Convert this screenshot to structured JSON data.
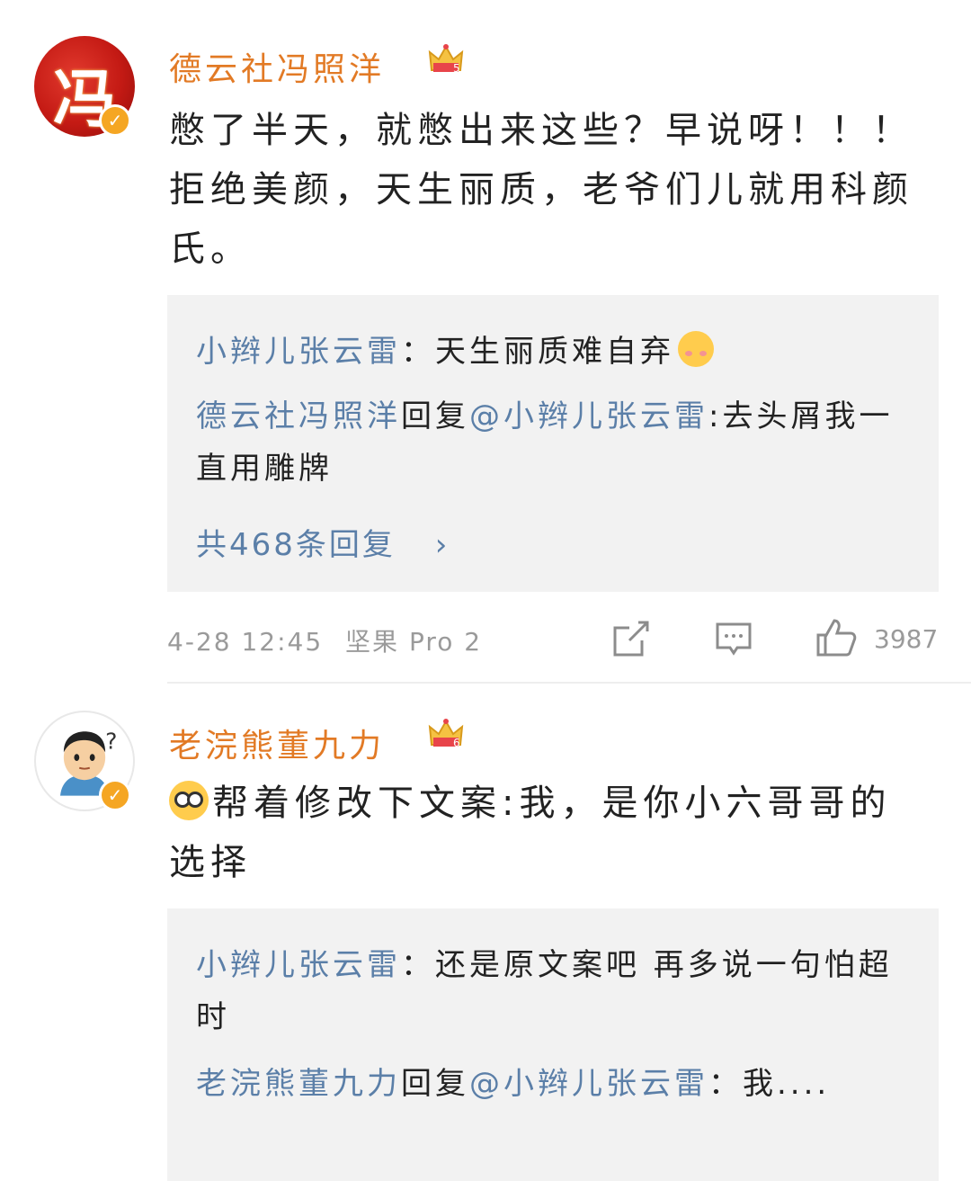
{
  "comments": [
    {
      "username": "德云社冯照洋",
      "avatar_glyph": "冯",
      "level_badge": "5",
      "text": "憋了半天，就憋出来这些？早说呀！！！        拒绝美颜，天生丽质，老爷们儿就用科颜氏。",
      "replies": [
        {
          "user": "小辫儿张云雷",
          "sep": "：",
          "text": "天生丽质难自弃"
        },
        {
          "user": "德云社冯照洋",
          "action": "回复",
          "mention": "@小辫儿张云雷",
          "sep": ":",
          "text": "去头屑我一直用雕牌"
        }
      ],
      "more_replies": "共468条回复",
      "timestamp": "4-28 12:45",
      "device": "坚果 Pro 2",
      "like_count": "3987"
    },
    {
      "username": "老浣熊董九力",
      "level_badge": "6",
      "text": "帮着修改下文案:我，是你小六哥哥的选择",
      "replies": [
        {
          "user": "小辫儿张云雷",
          "sep": "：",
          "text": "还是原文案吧 再多说一句怕超时"
        },
        {
          "user": "老浣熊董九力",
          "action": "回复",
          "mention": "@小辫儿张云雷",
          "sep": "：",
          "text": "我...."
        }
      ]
    }
  ],
  "colors": {
    "username": "#e27a25",
    "link": "#5b7fa8",
    "meta": "#9a9a9a",
    "reply_bg": "#f2f2f2",
    "verified": "#f5a623"
  }
}
